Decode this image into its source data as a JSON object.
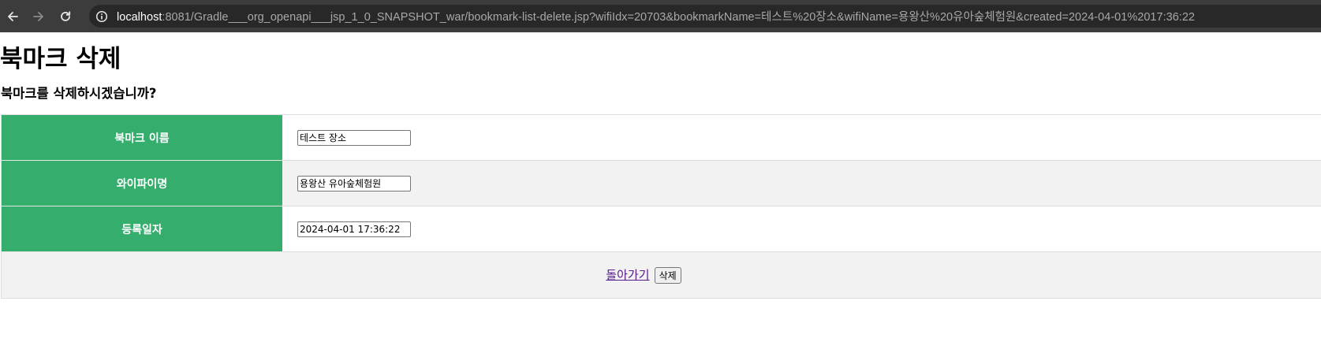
{
  "browser": {
    "url_host": "localhost",
    "url_rest": ":8081/Gradle___org_openapi___jsp_1_0_SNAPSHOT_war/bookmark-list-delete.jsp?wifiIdx=20703&bookmarkName=테스트%20장소&wifiName=용왕산%20유아숲체험원&created=2024-04-01%2017:36:22"
  },
  "page": {
    "title": "북마크 삭제",
    "question": "북마크를 삭제하시겠습니까?"
  },
  "form": {
    "rows": [
      {
        "label": "북마크 이름",
        "value": "테스트 장소"
      },
      {
        "label": "와이파이명",
        "value": "용왕산 유아숲체험원"
      },
      {
        "label": "등록일자",
        "value": "2024-04-01 17:36:22"
      }
    ],
    "back_link": "돌아가기",
    "delete_button": "삭제"
  },
  "colors": {
    "header_cell": "#34ad6d",
    "alt_row": "#f2f2f2",
    "visited_link": "#551a8b"
  }
}
